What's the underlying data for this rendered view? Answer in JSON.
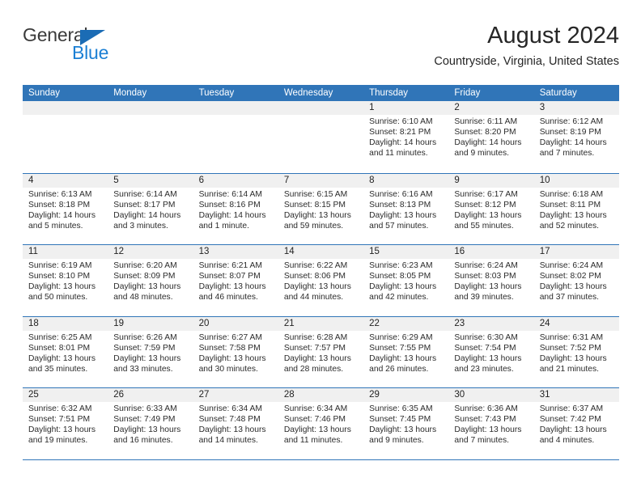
{
  "brand": {
    "name_top": "General",
    "name_bottom": "Blue",
    "triangle_color": "#1b6cb5",
    "blue_color": "#1b7fd4"
  },
  "header": {
    "month_title": "August 2024",
    "location": "Countryside, Virginia, United States"
  },
  "theme": {
    "header_blue": "#3075b8",
    "daynum_band": "#f0f0f0",
    "text": "#2b2b2b"
  },
  "calendar": {
    "weekdays": [
      "Sunday",
      "Monday",
      "Tuesday",
      "Wednesday",
      "Thursday",
      "Friday",
      "Saturday"
    ],
    "weeks": [
      [
        {
          "day": "",
          "sunrise": "",
          "sunset": "",
          "daylight": "",
          "empty": true
        },
        {
          "day": "",
          "sunrise": "",
          "sunset": "",
          "daylight": "",
          "empty": true
        },
        {
          "day": "",
          "sunrise": "",
          "sunset": "",
          "daylight": "",
          "empty": true
        },
        {
          "day": "",
          "sunrise": "",
          "sunset": "",
          "daylight": "",
          "empty": true
        },
        {
          "day": "1",
          "sunrise": "Sunrise: 6:10 AM",
          "sunset": "Sunset: 8:21 PM",
          "daylight": "Daylight: 14 hours and 11 minutes."
        },
        {
          "day": "2",
          "sunrise": "Sunrise: 6:11 AM",
          "sunset": "Sunset: 8:20 PM",
          "daylight": "Daylight: 14 hours and 9 minutes."
        },
        {
          "day": "3",
          "sunrise": "Sunrise: 6:12 AM",
          "sunset": "Sunset: 8:19 PM",
          "daylight": "Daylight: 14 hours and 7 minutes."
        }
      ],
      [
        {
          "day": "4",
          "sunrise": "Sunrise: 6:13 AM",
          "sunset": "Sunset: 8:18 PM",
          "daylight": "Daylight: 14 hours and 5 minutes."
        },
        {
          "day": "5",
          "sunrise": "Sunrise: 6:14 AM",
          "sunset": "Sunset: 8:17 PM",
          "daylight": "Daylight: 14 hours and 3 minutes."
        },
        {
          "day": "6",
          "sunrise": "Sunrise: 6:14 AM",
          "sunset": "Sunset: 8:16 PM",
          "daylight": "Daylight: 14 hours and 1 minute."
        },
        {
          "day": "7",
          "sunrise": "Sunrise: 6:15 AM",
          "sunset": "Sunset: 8:15 PM",
          "daylight": "Daylight: 13 hours and 59 minutes."
        },
        {
          "day": "8",
          "sunrise": "Sunrise: 6:16 AM",
          "sunset": "Sunset: 8:13 PM",
          "daylight": "Daylight: 13 hours and 57 minutes."
        },
        {
          "day": "9",
          "sunrise": "Sunrise: 6:17 AM",
          "sunset": "Sunset: 8:12 PM",
          "daylight": "Daylight: 13 hours and 55 minutes."
        },
        {
          "day": "10",
          "sunrise": "Sunrise: 6:18 AM",
          "sunset": "Sunset: 8:11 PM",
          "daylight": "Daylight: 13 hours and 52 minutes."
        }
      ],
      [
        {
          "day": "11",
          "sunrise": "Sunrise: 6:19 AM",
          "sunset": "Sunset: 8:10 PM",
          "daylight": "Daylight: 13 hours and 50 minutes."
        },
        {
          "day": "12",
          "sunrise": "Sunrise: 6:20 AM",
          "sunset": "Sunset: 8:09 PM",
          "daylight": "Daylight: 13 hours and 48 minutes."
        },
        {
          "day": "13",
          "sunrise": "Sunrise: 6:21 AM",
          "sunset": "Sunset: 8:07 PM",
          "daylight": "Daylight: 13 hours and 46 minutes."
        },
        {
          "day": "14",
          "sunrise": "Sunrise: 6:22 AM",
          "sunset": "Sunset: 8:06 PM",
          "daylight": "Daylight: 13 hours and 44 minutes."
        },
        {
          "day": "15",
          "sunrise": "Sunrise: 6:23 AM",
          "sunset": "Sunset: 8:05 PM",
          "daylight": "Daylight: 13 hours and 42 minutes."
        },
        {
          "day": "16",
          "sunrise": "Sunrise: 6:24 AM",
          "sunset": "Sunset: 8:03 PM",
          "daylight": "Daylight: 13 hours and 39 minutes."
        },
        {
          "day": "17",
          "sunrise": "Sunrise: 6:24 AM",
          "sunset": "Sunset: 8:02 PM",
          "daylight": "Daylight: 13 hours and 37 minutes."
        }
      ],
      [
        {
          "day": "18",
          "sunrise": "Sunrise: 6:25 AM",
          "sunset": "Sunset: 8:01 PM",
          "daylight": "Daylight: 13 hours and 35 minutes."
        },
        {
          "day": "19",
          "sunrise": "Sunrise: 6:26 AM",
          "sunset": "Sunset: 7:59 PM",
          "daylight": "Daylight: 13 hours and 33 minutes."
        },
        {
          "day": "20",
          "sunrise": "Sunrise: 6:27 AM",
          "sunset": "Sunset: 7:58 PM",
          "daylight": "Daylight: 13 hours and 30 minutes."
        },
        {
          "day": "21",
          "sunrise": "Sunrise: 6:28 AM",
          "sunset": "Sunset: 7:57 PM",
          "daylight": "Daylight: 13 hours and 28 minutes."
        },
        {
          "day": "22",
          "sunrise": "Sunrise: 6:29 AM",
          "sunset": "Sunset: 7:55 PM",
          "daylight": "Daylight: 13 hours and 26 minutes."
        },
        {
          "day": "23",
          "sunrise": "Sunrise: 6:30 AM",
          "sunset": "Sunset: 7:54 PM",
          "daylight": "Daylight: 13 hours and 23 minutes."
        },
        {
          "day": "24",
          "sunrise": "Sunrise: 6:31 AM",
          "sunset": "Sunset: 7:52 PM",
          "daylight": "Daylight: 13 hours and 21 minutes."
        }
      ],
      [
        {
          "day": "25",
          "sunrise": "Sunrise: 6:32 AM",
          "sunset": "Sunset: 7:51 PM",
          "daylight": "Daylight: 13 hours and 19 minutes."
        },
        {
          "day": "26",
          "sunrise": "Sunrise: 6:33 AM",
          "sunset": "Sunset: 7:49 PM",
          "daylight": "Daylight: 13 hours and 16 minutes."
        },
        {
          "day": "27",
          "sunrise": "Sunrise: 6:34 AM",
          "sunset": "Sunset: 7:48 PM",
          "daylight": "Daylight: 13 hours and 14 minutes."
        },
        {
          "day": "28",
          "sunrise": "Sunrise: 6:34 AM",
          "sunset": "Sunset: 7:46 PM",
          "daylight": "Daylight: 13 hours and 11 minutes."
        },
        {
          "day": "29",
          "sunrise": "Sunrise: 6:35 AM",
          "sunset": "Sunset: 7:45 PM",
          "daylight": "Daylight: 13 hours and 9 minutes."
        },
        {
          "day": "30",
          "sunrise": "Sunrise: 6:36 AM",
          "sunset": "Sunset: 7:43 PM",
          "daylight": "Daylight: 13 hours and 7 minutes."
        },
        {
          "day": "31",
          "sunrise": "Sunrise: 6:37 AM",
          "sunset": "Sunset: 7:42 PM",
          "daylight": "Daylight: 13 hours and 4 minutes."
        }
      ]
    ]
  }
}
